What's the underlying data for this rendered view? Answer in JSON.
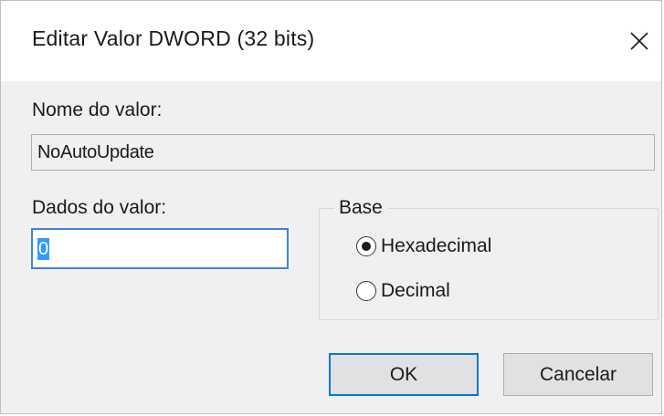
{
  "dialog": {
    "title": "Editar Valor DWORD (32 bits)",
    "close_icon": "close-icon"
  },
  "value_name": {
    "label": "Nome do valor:",
    "value": "NoAutoUpdate"
  },
  "value_data": {
    "label": "Dados do valor:",
    "value": "0"
  },
  "base": {
    "legend": "Base",
    "options": [
      {
        "label": "Hexadecimal",
        "selected": true
      },
      {
        "label": "Decimal",
        "selected": false
      }
    ]
  },
  "buttons": {
    "ok_label": "OK",
    "cancel_label": "Cancelar"
  },
  "colors": {
    "accent": "#0078d7",
    "selection": "#3399ff",
    "background": "#f0f0f0"
  }
}
